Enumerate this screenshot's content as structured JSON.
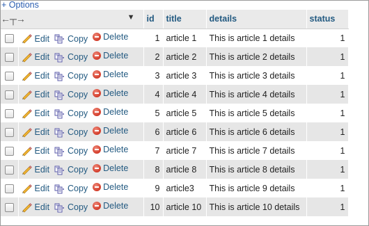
{
  "options_label": "Options",
  "columns": {
    "id": "id",
    "title": "title",
    "details": "details",
    "status": "status"
  },
  "actions": {
    "edit": "Edit",
    "copy": "Copy",
    "delete": "Delete"
  },
  "rows": [
    {
      "id": "1",
      "title": "article 1",
      "details": "This is article 1 details",
      "status": "1"
    },
    {
      "id": "2",
      "title": "article 2",
      "details": "This is article 2 details",
      "status": "1"
    },
    {
      "id": "3",
      "title": "article 3",
      "details": "This is article 3 details",
      "status": "1"
    },
    {
      "id": "4",
      "title": "article 4",
      "details": "This is article 4 details",
      "status": "1"
    },
    {
      "id": "5",
      "title": "article 5",
      "details": "This is article 5 details",
      "status": "1"
    },
    {
      "id": "6",
      "title": "article 6",
      "details": "This is article 6 details",
      "status": "1"
    },
    {
      "id": "7",
      "title": "article 7",
      "details": "This is article 7 details",
      "status": "1"
    },
    {
      "id": "8",
      "title": "article 8",
      "details": "This is article 8 details",
      "status": "1"
    },
    {
      "id": "9",
      "title": "article3",
      "details": "This is article 9 details",
      "status": "1"
    },
    {
      "id": "10",
      "title": "article 10",
      "details": "This is article 10 details",
      "status": "1"
    }
  ]
}
